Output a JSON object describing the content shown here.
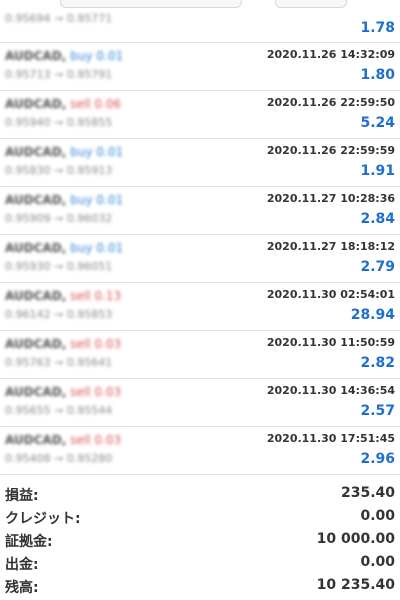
{
  "trades": [
    {
      "symbol": "AUDCAD,",
      "side": "buy",
      "side_label": "buy 0.01",
      "price_open": "0.95694",
      "price_close": "0.95771",
      "time": "",
      "profit": "1.78"
    },
    {
      "symbol": "AUDCAD,",
      "side": "buy",
      "side_label": "buy 0.01",
      "price_open": "0.95713",
      "price_close": "0.95791",
      "time": "2020.11.26 14:32:09",
      "profit": "1.80"
    },
    {
      "symbol": "AUDCAD,",
      "side": "sell",
      "side_label": "sell 0.06",
      "price_open": "0.95940",
      "price_close": "0.95855",
      "time": "2020.11.26 22:59:50",
      "profit": "5.24"
    },
    {
      "symbol": "AUDCAD,",
      "side": "buy",
      "side_label": "buy 0.01",
      "price_open": "0.95830",
      "price_close": "0.95913",
      "time": "2020.11.26 22:59:59",
      "profit": "1.91"
    },
    {
      "symbol": "AUDCAD,",
      "side": "buy",
      "side_label": "buy 0.01",
      "price_open": "0.95909",
      "price_close": "0.96032",
      "time": "2020.11.27 10:28:36",
      "profit": "2.84"
    },
    {
      "symbol": "AUDCAD,",
      "side": "buy",
      "side_label": "buy 0.01",
      "price_open": "0.95930",
      "price_close": "0.96051",
      "time": "2020.11.27 18:18:12",
      "profit": "2.79"
    },
    {
      "symbol": "AUDCAD,",
      "side": "sell",
      "side_label": "sell 0.13",
      "price_open": "0.96142",
      "price_close": "0.95853",
      "time": "2020.11.30 02:54:01",
      "profit": "28.94"
    },
    {
      "symbol": "AUDCAD,",
      "side": "sell",
      "side_label": "sell 0.03",
      "price_open": "0.95763",
      "price_close": "0.95641",
      "time": "2020.11.30 11:50:59",
      "profit": "2.82"
    },
    {
      "symbol": "AUDCAD,",
      "side": "sell",
      "side_label": "sell 0.03",
      "price_open": "0.95655",
      "price_close": "0.95544",
      "time": "2020.11.30 14:36:54",
      "profit": "2.57"
    },
    {
      "symbol": "AUDCAD,",
      "side": "sell",
      "side_label": "sell 0.03",
      "price_open": "0.95408",
      "price_close": "0.95280",
      "time": "2020.11.30 17:51:45",
      "profit": "2.96"
    }
  ],
  "summary": {
    "profit_label": "損益:",
    "profit_value": "235.40",
    "credit_label": "クレジット:",
    "credit_value": "0.00",
    "deposit_label": "証拠金:",
    "deposit_value": "10 000.00",
    "withdrawal_label": "出金:",
    "withdrawal_value": "0.00",
    "balance_label": "残高:",
    "balance_value": "10 235.40"
  },
  "colors": {
    "profit": "#1f6fd1",
    "buy": "#2f7fd6",
    "sell": "#d9534f"
  }
}
